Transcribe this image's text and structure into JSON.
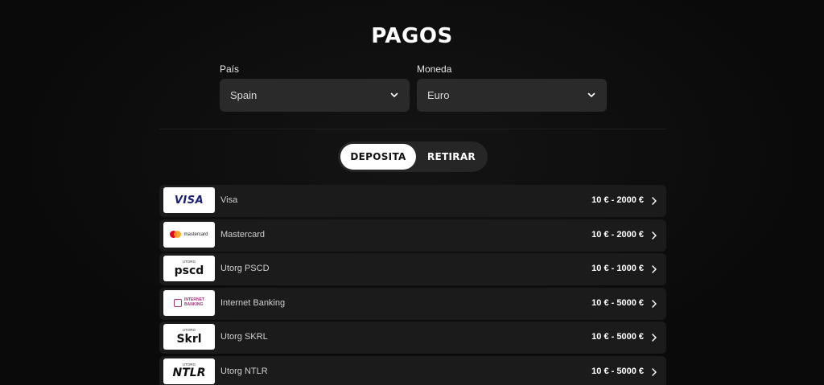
{
  "page": {
    "title": "PAGOS"
  },
  "filters": {
    "country_label": "País",
    "country_value": "Spain",
    "currency_label": "Moneda",
    "currency_value": "Euro"
  },
  "tabs": {
    "deposit": "DEPOSITA",
    "withdraw": "RETIRAR",
    "active": "deposit"
  },
  "methods": [
    {
      "name": "Visa",
      "range": "10 € - 2000 €",
      "logo": "visa-logo",
      "logo_text": "VISA"
    },
    {
      "name": "Mastercard",
      "range": "10 € - 2000 €",
      "logo": "mastercard-logo",
      "logo_text": "mastercard"
    },
    {
      "name": "Utorg PSCD",
      "range": "10 € - 1000 €",
      "logo": "utorg-pscd-logo",
      "logo_small": "UTORG",
      "logo_text": "pscd"
    },
    {
      "name": "Internet Banking",
      "range": "10 € - 5000 €",
      "logo": "internet-banking-logo",
      "logo_text_1": "INTERNET",
      "logo_text_2": "BANKING"
    },
    {
      "name": "Utorg SKRL",
      "range": "10 € - 5000 €",
      "logo": "utorg-skrl-logo",
      "logo_small": "UTORG",
      "logo_text": "Skrl"
    },
    {
      "name": "Utorg NTLR",
      "range": "10 € - 5000 €",
      "logo": "utorg-ntlr-logo",
      "logo_small": "UTORG",
      "logo_text": "NTLR"
    }
  ],
  "icons": {
    "select_chevron": "chevron-down-icon",
    "row_chevron": "chevron-right-icon"
  },
  "colors": {
    "background": "#0c0c0c",
    "select_bg": "#2a2a2a",
    "row_bg": "#1b1b1b",
    "toggle_bg": "#262626",
    "active_tab_bg": "#ffffff",
    "visa_blue": "#1a1f71",
    "mastercard_red": "#eb001b",
    "mastercard_orange": "#f79e1b",
    "internet_banking_magenta": "#a0337d"
  }
}
